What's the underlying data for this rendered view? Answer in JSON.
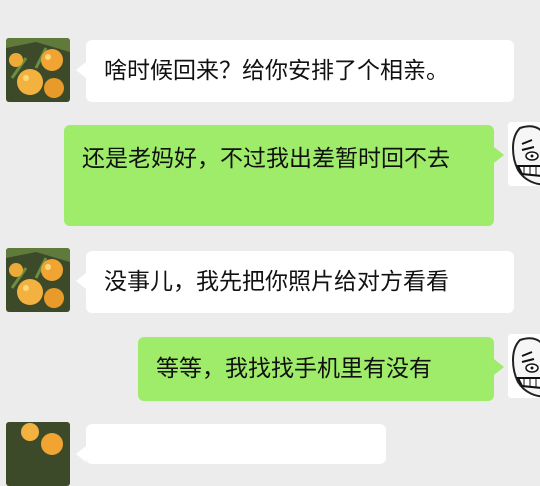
{
  "colors": {
    "background": "#ececec",
    "received_bubble": "#ffffff",
    "sent_bubble": "#9feb6a",
    "text": "#111111"
  },
  "messages": [
    {
      "side": "received",
      "avatar": "orange-tree-avatar",
      "text": "啥时候回来？给你安排了个相亲。"
    },
    {
      "side": "sent",
      "avatar": "rage-face-avatar",
      "text": "还是老妈好，不过我出差暂时回不去"
    },
    {
      "side": "received",
      "avatar": "orange-tree-avatar",
      "text": "没事儿，我先把你照片给对方看看"
    },
    {
      "side": "sent",
      "avatar": "rage-face-avatar",
      "text": "等等，我找找手机里有没有"
    },
    {
      "side": "received",
      "avatar": "orange-tree-avatar",
      "text": ""
    }
  ]
}
